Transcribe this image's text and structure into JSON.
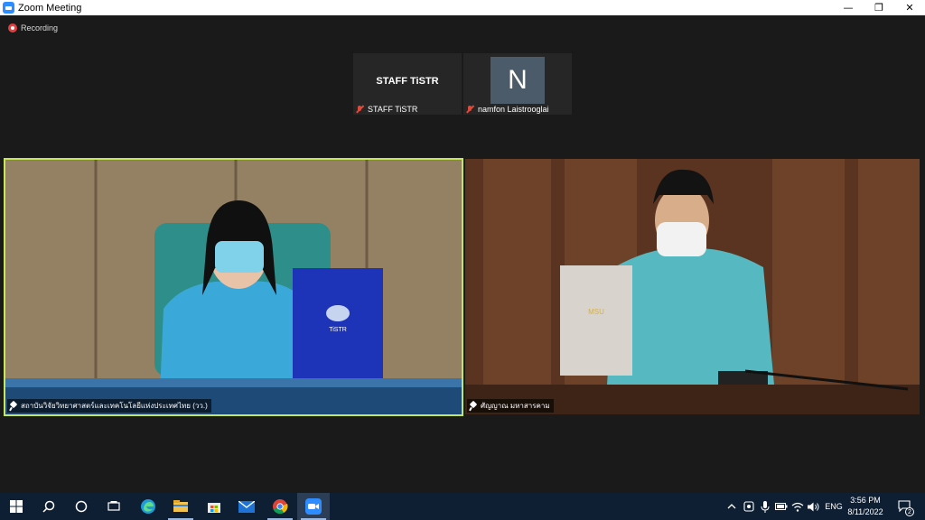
{
  "window": {
    "title": "Zoom Meeting",
    "minimize": "—",
    "maximize": "❐",
    "close": "✕"
  },
  "meeting": {
    "recording_label": "Recording",
    "thumbnails": [
      {
        "display": "STAFF TiSTR",
        "name": "STAFF TiSTR",
        "muted": true
      },
      {
        "display": "N",
        "name": "namfon Laistrooglai",
        "muted": true
      }
    ],
    "videos": [
      {
        "name": "สถาบันวิจัยวิทยาศาสตร์และเทคโนโลยีแห่งประเทศไทย (วว.)",
        "active_speaker": true,
        "folder_text": "TiSTR"
      },
      {
        "name": "ศัญญาณ มหาสารคาม",
        "active_speaker": false,
        "folder_text": "MSU"
      }
    ]
  },
  "taskbar": {
    "apps": [
      "windows-logo",
      "search",
      "cortana",
      "task-view",
      "edge",
      "file-explorer",
      "store",
      "mail",
      "chrome",
      "zoom"
    ],
    "language": "ENG",
    "time": "3:56 PM",
    "date": "8/11/2022",
    "notifications": "2"
  },
  "colors": {
    "active_speaker_border": "#c8e65a",
    "taskbar": "#0f1f33",
    "muted": "#e04a3a"
  }
}
